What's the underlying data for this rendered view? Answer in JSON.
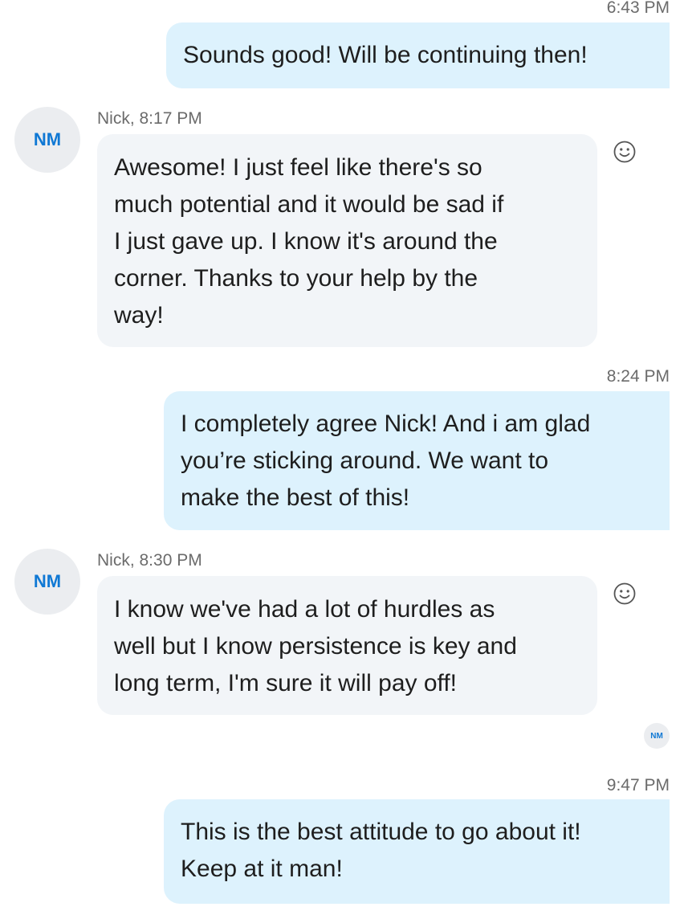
{
  "messages": [
    {
      "direction": "outgoing",
      "time": "6:43 PM",
      "lines": [
        "Sounds good! Will be continuing then!"
      ]
    },
    {
      "direction": "incoming",
      "avatar": "NM",
      "sender_line": "Nick, 8:17 PM",
      "lines": [
        "Awesome! I just feel like there's so",
        "much potential and it would be sad if",
        "I just gave up. I know it's around the",
        "corner. Thanks to your help by the",
        "way!"
      ],
      "reaction_icon": "smiley-face-icon"
    },
    {
      "direction": "outgoing",
      "time": "8:24 PM",
      "lines": [
        "I completely agree Nick! And i am glad",
        "you’re sticking around. We want to",
        "make the best of this!"
      ]
    },
    {
      "direction": "incoming",
      "avatar": "NM",
      "sender_line": "Nick, 8:30 PM",
      "lines": [
        "I know we've had a lot of hurdles as",
        "well but I know persistence is key and",
        "long term, I'm sure it will pay off!"
      ],
      "reaction_icon": "smiley-face-icon"
    },
    {
      "direction": "outgoing",
      "time": "9:47 PM",
      "lines": [
        "This is the best attitude to go about it!",
        "Keep at it man!"
      ]
    }
  ],
  "read_receipt": {
    "avatar": "NM"
  },
  "colors": {
    "outgoing_bubble": "#ddf2fd",
    "incoming_bubble": "#f2f5f8",
    "avatar_text": "#0f78d4",
    "avatar_bg": "#ebedf0",
    "meta_text": "#6b6b6b"
  }
}
